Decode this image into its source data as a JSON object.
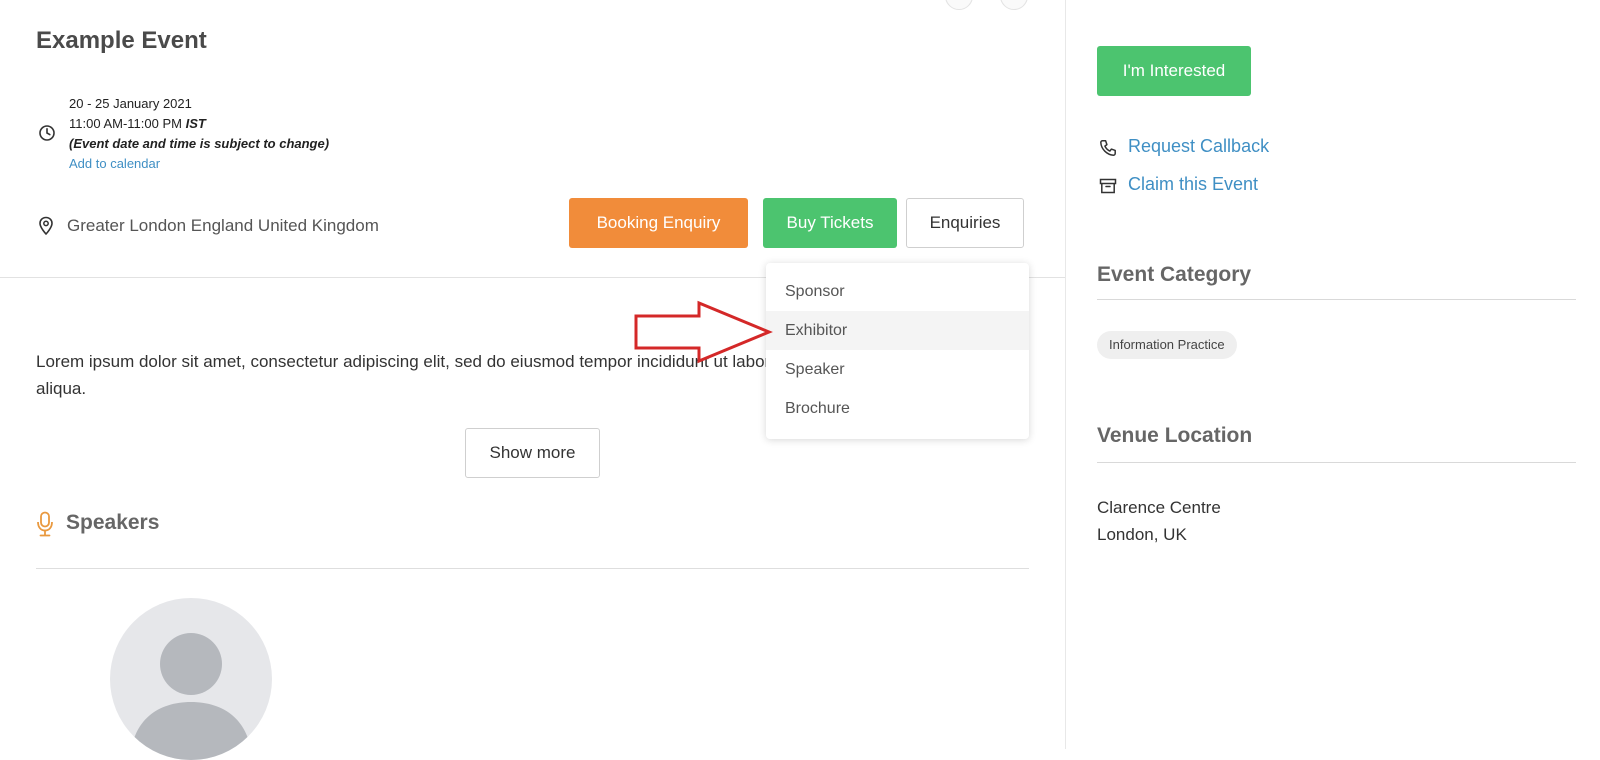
{
  "event": {
    "title": "Example Event",
    "date_range": "20 - 25 January 2021",
    "time": "11:00 AM-11:00 PM",
    "timezone": "IST",
    "disclaimer": "(Event date and time is subject to change)",
    "add_to_calendar": "Add to calendar",
    "location": "Greater London England United Kingdom"
  },
  "actions": {
    "booking_enquiry": "Booking Enquiry",
    "buy_tickets": "Buy Tickets",
    "enquiries": "Enquiries"
  },
  "enquiries_menu": {
    "items": [
      "Sponsor",
      "Exhibitor",
      "Speaker",
      "Brochure"
    ],
    "highlighted": "Exhibitor"
  },
  "description": {
    "line1": "Lorem ipsum dolor sit amet, consectetur adipiscing elit, sed do eiusmod tempor incididunt ut labore et dolore magna",
    "line2": "aliqua.",
    "show_more": "Show more"
  },
  "speakers": {
    "heading": "Speakers"
  },
  "sidebar": {
    "interested": "I'm Interested",
    "request_callback": "Request Callback",
    "claim_event": "Claim this Event",
    "category_heading": "Event Category",
    "category_tag": "Information Practice",
    "venue_heading": "Venue Location",
    "venue_name": "Clarence Centre",
    "venue_city": "London, UK"
  },
  "icons": {
    "clock": "clock-icon",
    "location": "map-pin-icon",
    "microphone": "microphone-icon",
    "phone": "phone-icon",
    "archive": "archive-icon",
    "arrow": "red-arrow-annotation"
  },
  "colors": {
    "orange": "#f18c3a",
    "green": "#4cc46f",
    "link": "#3f8fc4",
    "mic": "#e9993f",
    "arrow": "#d42828"
  }
}
